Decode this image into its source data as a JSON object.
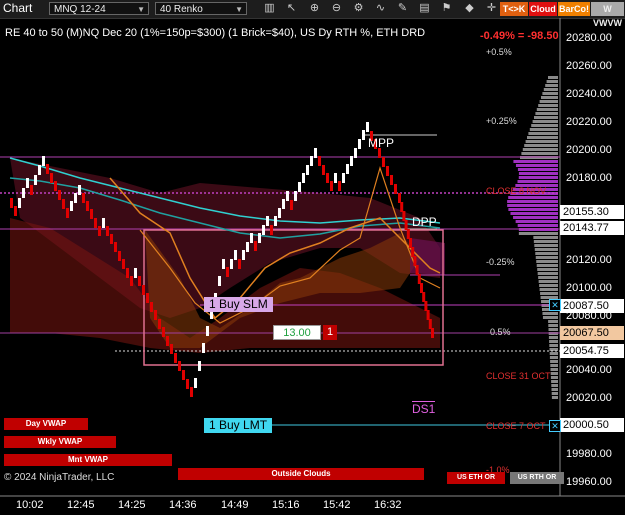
{
  "app": {
    "title": "Chart"
  },
  "toolbar": {
    "instrument": "MNQ 12-24",
    "bar_type": "40 Renko",
    "tool_txk": "T<>K",
    "tool_cloud": "Cloud",
    "tool_barco": "BarCo!",
    "tool_w": "W VWVW"
  },
  "header": {
    "info": "RE 40 to 50 (M)NQ Dec 20 (1%=150p=$300) (1 Brick=$40), US Dy RTH %, ETH DRD",
    "change": "-0.49% = -98.50"
  },
  "price_axis": {
    "ticks": [
      "20280.00",
      "20260.00",
      "20240.00",
      "20220.00",
      "20200.00",
      "20180.00",
      "20120.00",
      "20100.00",
      "20080.00",
      "20040.00",
      "20020.00",
      "19980.00",
      "19960.00"
    ]
  },
  "price_boxes": {
    "p1": "20155.30",
    "p2": "20143.77",
    "p3": "20087.50",
    "p4": "20067.50",
    "p5": "20054.75",
    "p6": "20000.50"
  },
  "time_axis": [
    "10:02",
    "12:45",
    "14:25",
    "14:36",
    "14:49",
    "15:16",
    "15:42",
    "16:32"
  ],
  "levels": {
    "pct_p05": "+0.5%",
    "pct_p025": "+0.25%",
    "close_now": "CLOSE 8 NOV",
    "pct_m025": "-0.25%",
    "pct_05": "0.5%",
    "close_31": "CLOSE 31 OCT",
    "close_7": "CLOSE 7 OCT",
    "pct_m1": "-1.0%",
    "mpp": "MPP",
    "dpp": "DPP",
    "ds1": "DS1"
  },
  "orders": {
    "buy_slm": "1 Buy SLM",
    "buy_lmt": "1 Buy LMT",
    "pnl": "13.00",
    "qty": "1"
  },
  "buttons": {
    "day_vwap": "Day VWAP",
    "wkly_vwap": "Wkly VWAP",
    "mnt_vwap": "Mnt VWAP",
    "outside_clouds": "Outside Clouds",
    "us_eth": "US ETH OR",
    "us_rth": "US RTH OR"
  },
  "footer": {
    "copyright": "© 2024 NinjaTrader, LLC"
  },
  "colors": {
    "up": "#ffffff",
    "down": "#e00000",
    "magenta": "#d040d0",
    "cyan": "#20c8c8",
    "orange": "#e08020"
  }
}
